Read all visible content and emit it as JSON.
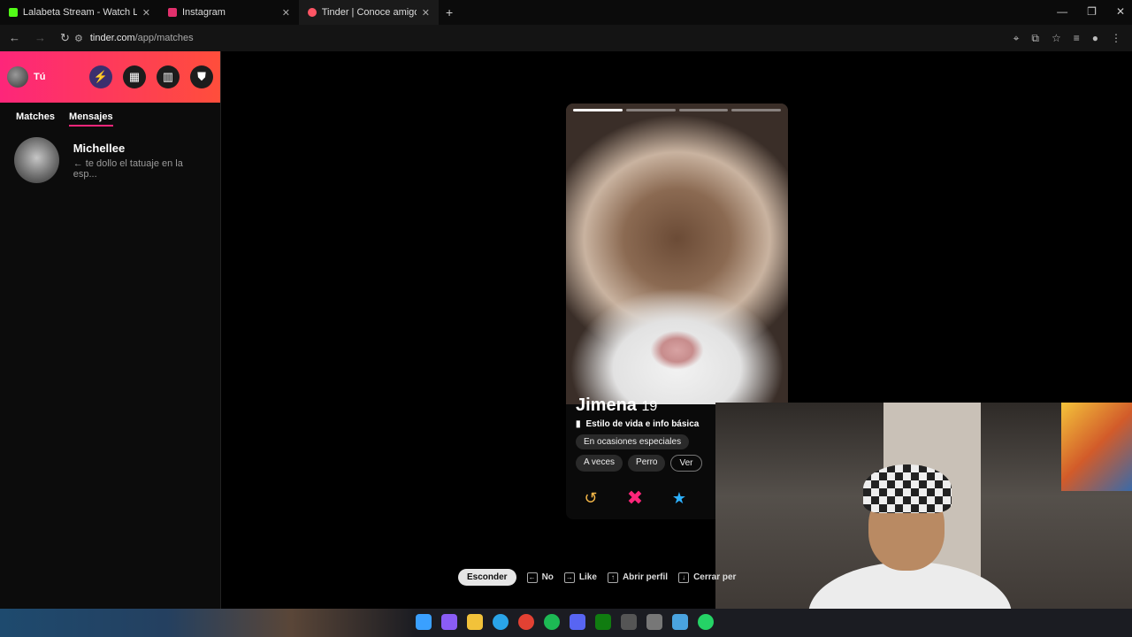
{
  "browser": {
    "tabs": [
      {
        "label": "Lalabeta Stream - Watch Live o",
        "color": "#53fc18"
      },
      {
        "label": "Instagram",
        "color": "#e1306c"
      },
      {
        "label": "Tinder | Conoce amigos y gent",
        "color": "#fd5564",
        "active": true
      }
    ],
    "url_host": "tinder.com",
    "url_path": "/app/matches"
  },
  "sidebar": {
    "user_label": "Tú",
    "tabs": [
      {
        "label": "Matches",
        "selected": false
      },
      {
        "label": "Mensajes",
        "selected": true
      }
    ],
    "messages": [
      {
        "name": "Michellee",
        "preview": "← te dollo el tatuaje en la esp..."
      }
    ]
  },
  "profile": {
    "name": "Jimena",
    "age": "19",
    "section_title": "Estilo de vida e info básica",
    "pills_row1": [
      "En ocasiones especiales"
    ],
    "pills_row2": [
      "A veces",
      "Perro",
      "Ver"
    ],
    "photo_count": 4,
    "active_photo": 1
  },
  "shortcuts": {
    "hide": "Esconder",
    "no": "No",
    "like": "Like",
    "open": "Abrir perfil",
    "close": "Cerrar per"
  }
}
